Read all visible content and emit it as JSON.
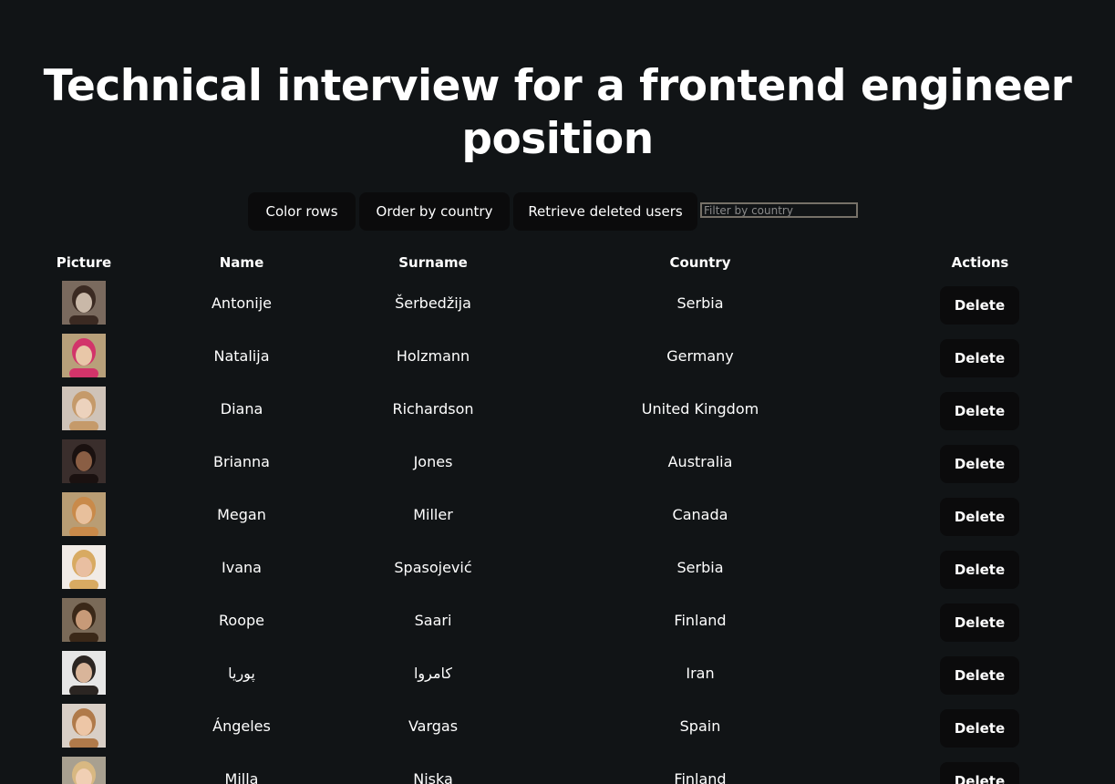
{
  "title": "Technical interview for a frontend engineer position",
  "toolbar": {
    "color_rows": "Color rows",
    "order_by_country": "Order by country",
    "retrieve_deleted": "Retrieve deleted users",
    "filter_placeholder": "Filter by country"
  },
  "table": {
    "headers": {
      "picture": "Picture",
      "name": "Name",
      "surname": "Surname",
      "country": "Country",
      "actions": "Actions"
    },
    "rows": [
      {
        "name": "Antonije",
        "surname": "Šerbedžija",
        "country": "Serbia",
        "action": "Delete"
      },
      {
        "name": "Natalija",
        "surname": "Holzmann",
        "country": "Germany",
        "action": "Delete"
      },
      {
        "name": "Diana",
        "surname": "Richardson",
        "country": "United Kingdom",
        "action": "Delete"
      },
      {
        "name": "Brianna",
        "surname": "Jones",
        "country": "Australia",
        "action": "Delete"
      },
      {
        "name": "Megan",
        "surname": "Miller",
        "country": "Canada",
        "action": "Delete"
      },
      {
        "name": "Ivana",
        "surname": "Spasojević",
        "country": "Serbia",
        "action": "Delete"
      },
      {
        "name": "Roope",
        "surname": "Saari",
        "country": "Finland",
        "action": "Delete"
      },
      {
        "name": "پوریا",
        "surname": "کامروا",
        "country": "Iran",
        "action": "Delete"
      },
      {
        "name": "Ángeles",
        "surname": "Vargas",
        "country": "Spain",
        "action": "Delete"
      },
      {
        "name": "Milla",
        "surname": "Niska",
        "country": "Finland",
        "action": "Delete"
      }
    ]
  },
  "colors": {
    "background": "#111416",
    "button": "#0b0b0c",
    "text": "#ffffff",
    "input_border": "#767168"
  }
}
